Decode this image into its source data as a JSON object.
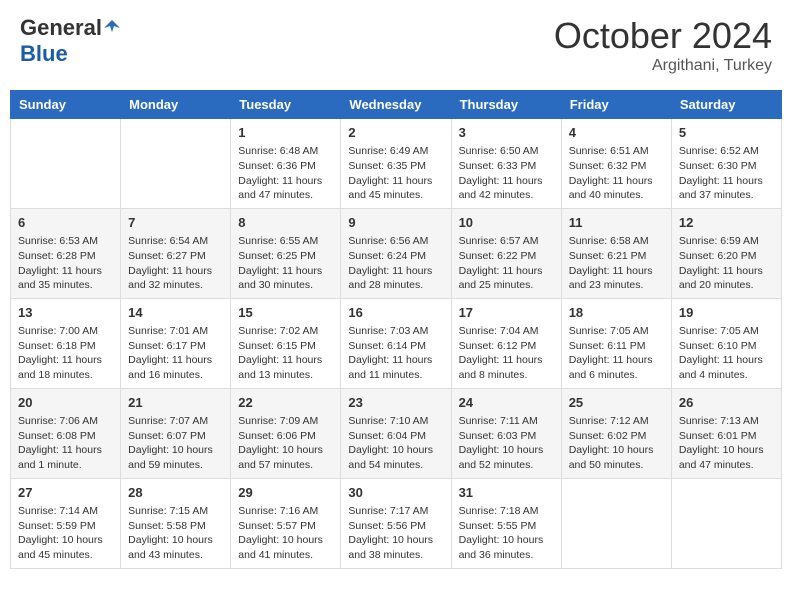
{
  "header": {
    "logo_general": "General",
    "logo_blue": "Blue",
    "month_title": "October 2024",
    "location": "Argithani, Turkey"
  },
  "weekdays": [
    "Sunday",
    "Monday",
    "Tuesday",
    "Wednesday",
    "Thursday",
    "Friday",
    "Saturday"
  ],
  "weeks": [
    [
      null,
      null,
      {
        "day": 1,
        "sunrise": "6:48 AM",
        "sunset": "6:36 PM",
        "daylight": "11 hours and 47 minutes."
      },
      {
        "day": 2,
        "sunrise": "6:49 AM",
        "sunset": "6:35 PM",
        "daylight": "11 hours and 45 minutes."
      },
      {
        "day": 3,
        "sunrise": "6:50 AM",
        "sunset": "6:33 PM",
        "daylight": "11 hours and 42 minutes."
      },
      {
        "day": 4,
        "sunrise": "6:51 AM",
        "sunset": "6:32 PM",
        "daylight": "11 hours and 40 minutes."
      },
      {
        "day": 5,
        "sunrise": "6:52 AM",
        "sunset": "6:30 PM",
        "daylight": "11 hours and 37 minutes."
      }
    ],
    [
      {
        "day": 6,
        "sunrise": "6:53 AM",
        "sunset": "6:28 PM",
        "daylight": "11 hours and 35 minutes."
      },
      {
        "day": 7,
        "sunrise": "6:54 AM",
        "sunset": "6:27 PM",
        "daylight": "11 hours and 32 minutes."
      },
      {
        "day": 8,
        "sunrise": "6:55 AM",
        "sunset": "6:25 PM",
        "daylight": "11 hours and 30 minutes."
      },
      {
        "day": 9,
        "sunrise": "6:56 AM",
        "sunset": "6:24 PM",
        "daylight": "11 hours and 28 minutes."
      },
      {
        "day": 10,
        "sunrise": "6:57 AM",
        "sunset": "6:22 PM",
        "daylight": "11 hours and 25 minutes."
      },
      {
        "day": 11,
        "sunrise": "6:58 AM",
        "sunset": "6:21 PM",
        "daylight": "11 hours and 23 minutes."
      },
      {
        "day": 12,
        "sunrise": "6:59 AM",
        "sunset": "6:20 PM",
        "daylight": "11 hours and 20 minutes."
      }
    ],
    [
      {
        "day": 13,
        "sunrise": "7:00 AM",
        "sunset": "6:18 PM",
        "daylight": "11 hours and 18 minutes."
      },
      {
        "day": 14,
        "sunrise": "7:01 AM",
        "sunset": "6:17 PM",
        "daylight": "11 hours and 16 minutes."
      },
      {
        "day": 15,
        "sunrise": "7:02 AM",
        "sunset": "6:15 PM",
        "daylight": "11 hours and 13 minutes."
      },
      {
        "day": 16,
        "sunrise": "7:03 AM",
        "sunset": "6:14 PM",
        "daylight": "11 hours and 11 minutes."
      },
      {
        "day": 17,
        "sunrise": "7:04 AM",
        "sunset": "6:12 PM",
        "daylight": "11 hours and 8 minutes."
      },
      {
        "day": 18,
        "sunrise": "7:05 AM",
        "sunset": "6:11 PM",
        "daylight": "11 hours and 6 minutes."
      },
      {
        "day": 19,
        "sunrise": "7:05 AM",
        "sunset": "6:10 PM",
        "daylight": "11 hours and 4 minutes."
      }
    ],
    [
      {
        "day": 20,
        "sunrise": "7:06 AM",
        "sunset": "6:08 PM",
        "daylight": "11 hours and 1 minute."
      },
      {
        "day": 21,
        "sunrise": "7:07 AM",
        "sunset": "6:07 PM",
        "daylight": "10 hours and 59 minutes."
      },
      {
        "day": 22,
        "sunrise": "7:09 AM",
        "sunset": "6:06 PM",
        "daylight": "10 hours and 57 minutes."
      },
      {
        "day": 23,
        "sunrise": "7:10 AM",
        "sunset": "6:04 PM",
        "daylight": "10 hours and 54 minutes."
      },
      {
        "day": 24,
        "sunrise": "7:11 AM",
        "sunset": "6:03 PM",
        "daylight": "10 hours and 52 minutes."
      },
      {
        "day": 25,
        "sunrise": "7:12 AM",
        "sunset": "6:02 PM",
        "daylight": "10 hours and 50 minutes."
      },
      {
        "day": 26,
        "sunrise": "7:13 AM",
        "sunset": "6:01 PM",
        "daylight": "10 hours and 47 minutes."
      }
    ],
    [
      {
        "day": 27,
        "sunrise": "7:14 AM",
        "sunset": "5:59 PM",
        "daylight": "10 hours and 45 minutes."
      },
      {
        "day": 28,
        "sunrise": "7:15 AM",
        "sunset": "5:58 PM",
        "daylight": "10 hours and 43 minutes."
      },
      {
        "day": 29,
        "sunrise": "7:16 AM",
        "sunset": "5:57 PM",
        "daylight": "10 hours and 41 minutes."
      },
      {
        "day": 30,
        "sunrise": "7:17 AM",
        "sunset": "5:56 PM",
        "daylight": "10 hours and 38 minutes."
      },
      {
        "day": 31,
        "sunrise": "7:18 AM",
        "sunset": "5:55 PM",
        "daylight": "10 hours and 36 minutes."
      },
      null,
      null
    ]
  ]
}
